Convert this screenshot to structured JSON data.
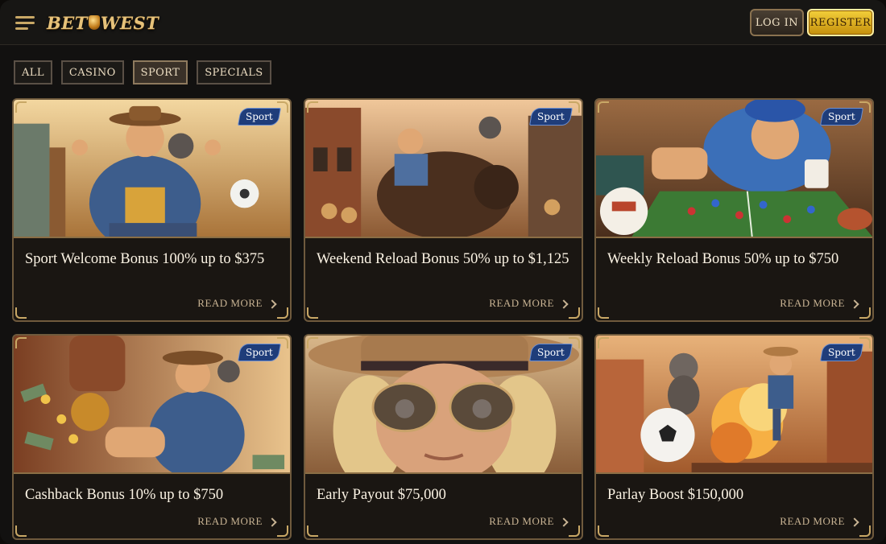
{
  "header": {
    "menu_icon": "hamburger-menu-icon",
    "logo_text_left": "BET",
    "logo_text_right": "WEST",
    "login_label": "LOG IN",
    "register_label": "REGISTER"
  },
  "filters": [
    {
      "label": "ALL",
      "active": false
    },
    {
      "label": "CASINO",
      "active": false
    },
    {
      "label": "SPORT",
      "active": true
    },
    {
      "label": "SPECIALS",
      "active": false
    }
  ],
  "cards": [
    {
      "tag": "Sport",
      "title": "Sport Welcome Bonus 100% up to $375",
      "cta": "READ MORE"
    },
    {
      "tag": "Sport",
      "title": "Weekend Reload Bonus 50% up to $1,125",
      "cta": "READ MORE"
    },
    {
      "tag": "Sport",
      "title": "Weekly Reload Bonus 50% up to $750",
      "cta": "READ MORE"
    },
    {
      "tag": "Sport",
      "title": "Cashback Bonus 10% up to $750",
      "cta": "READ MORE"
    },
    {
      "tag": "Sport",
      "title": "Early Payout $75,000",
      "cta": "READ MORE"
    },
    {
      "tag": "Sport",
      "title": "Parlay Boost $150,000",
      "cta": "READ MORE"
    }
  ],
  "colors": {
    "accent_gold": "#c9a866",
    "register_gold": "#f3cf3a",
    "tag_blue": "#1f3d7a",
    "background": "#121110"
  }
}
